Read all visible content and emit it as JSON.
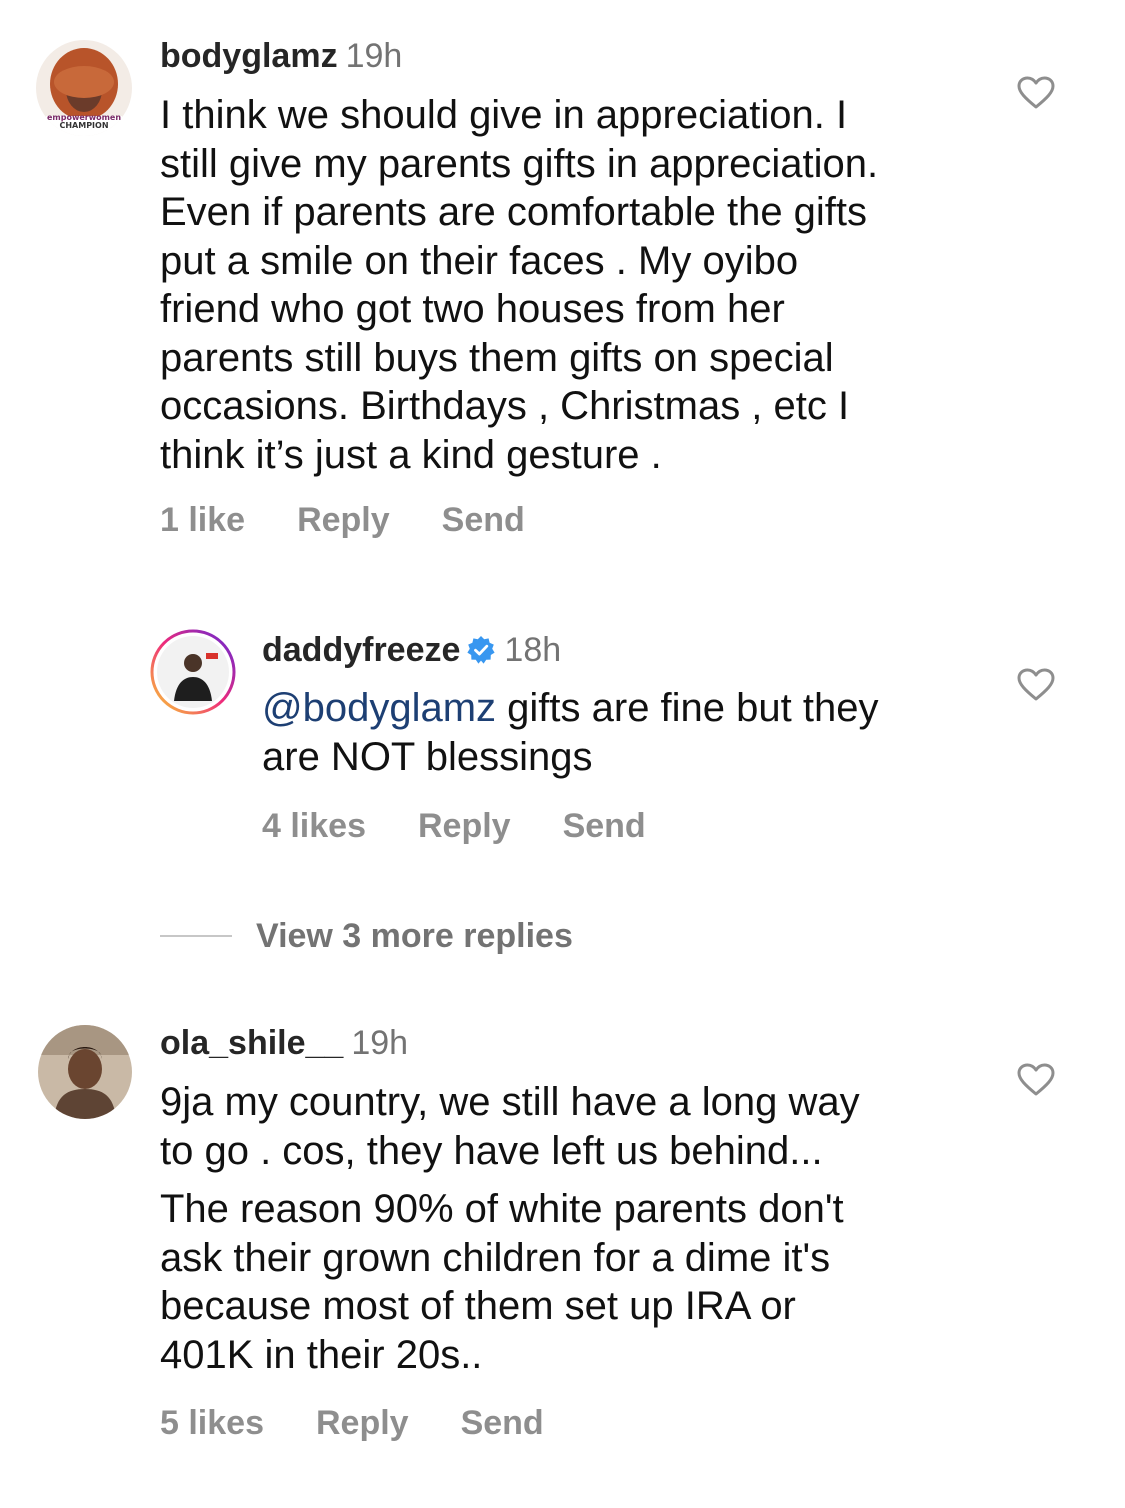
{
  "comments": [
    {
      "username": "bodyglamz",
      "time": "19h",
      "avatar_caption": [
        "empowerwomen",
        "CHAMPION"
      ],
      "text_lines": [
        "I think we should give in appreciation. I",
        "still give my parents gifts in appreciation.",
        "Even if parents are comfortable the gifts",
        "put a smile on their faces . My oyibo",
        "friend who got two houses from her",
        "parents still buys them gifts on special",
        "occasions. Birthdays , Christmas , etc I",
        "think it’s just a kind gesture ."
      ],
      "likes": "1 like",
      "reply_label": "Reply",
      "send_label": "Send",
      "like_icon": "heart-outline-icon"
    },
    {
      "username": "daddyfreeze",
      "verified": true,
      "verified_color": "#3897f0",
      "time": "18h",
      "mention": "@bodyglamz",
      "text_line_1": " gifts are fine but they",
      "text_line_2": "are NOT blessings",
      "likes": "4 likes",
      "reply_label": "Reply",
      "send_label": "Send",
      "like_icon": "heart-outline-icon"
    },
    {
      "username": "ola_shile__",
      "time": "19h",
      "text_lines_1": [
        "9ja my country, we still have a long way",
        "to go . cos, they have left us behind..."
      ],
      "text_lines_2": [
        "The reason 90% of white parents don't",
        "ask their grown children for a dime it's",
        "because most of them set up IRA or",
        "401K in their 20s.."
      ],
      "likes": "5 likes",
      "reply_label": "Reply",
      "send_label": "Send",
      "like_icon": "heart-outline-icon"
    }
  ],
  "view_more_replies": "View 3 more replies",
  "colors": {
    "username": "#262626",
    "secondary": "#8e8e8e",
    "mention": "#1d3f73",
    "story_ring_start": "#f9ce34",
    "story_ring_mid": "#ee2a7b",
    "story_ring_end": "#6228d7"
  }
}
